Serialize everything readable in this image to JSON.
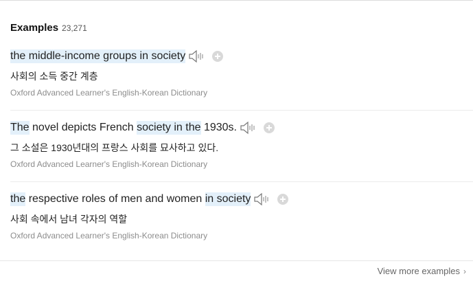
{
  "header": {
    "title": "Examples",
    "count": "23,271"
  },
  "examples": [
    {
      "tokens": [
        {
          "t": "the",
          "hl": true
        },
        {
          "t": " middle-income groups ",
          "hl": true
        },
        {
          "t": "in",
          "hl": true
        },
        {
          "t": " ",
          "hl": true
        },
        {
          "t": "society",
          "hl": true
        }
      ],
      "translation": "사회의 소득 중간 계층",
      "source": "Oxford Advanced Learner's English-Korean Dictionary"
    },
    {
      "tokens": [
        {
          "t": "The",
          "hl": true
        },
        {
          "t": " novel depicts French ",
          "hl": false
        },
        {
          "t": "society",
          "hl": true
        },
        {
          "t": " ",
          "hl": true
        },
        {
          "t": "in",
          "hl": true
        },
        {
          "t": " ",
          "hl": true
        },
        {
          "t": "the",
          "hl": true
        },
        {
          "t": " 1930s.",
          "hl": false
        }
      ],
      "translation": "그 소설은 1930년대의 프랑스 사회를 묘사하고 있다.",
      "source": "Oxford Advanced Learner's English-Korean Dictionary"
    },
    {
      "tokens": [
        {
          "t": "the",
          "hl": true
        },
        {
          "t": " respective roles of men and women ",
          "hl": false
        },
        {
          "t": "in",
          "hl": true
        },
        {
          "t": " ",
          "hl": true
        },
        {
          "t": "society",
          "hl": true
        }
      ],
      "translation": "사회 속에서 남녀 각자의 역할",
      "source": "Oxford Advanced Learner's English-Korean Dictionary"
    }
  ],
  "footer": {
    "view_more": "View more examples"
  },
  "icons": {
    "speaker": "speaker-icon",
    "add": "plus-circle-icon",
    "chevron": "chevron-right-icon"
  },
  "colors": {
    "highlight": "#e3f0fa",
    "source": "#8c8c8c"
  }
}
